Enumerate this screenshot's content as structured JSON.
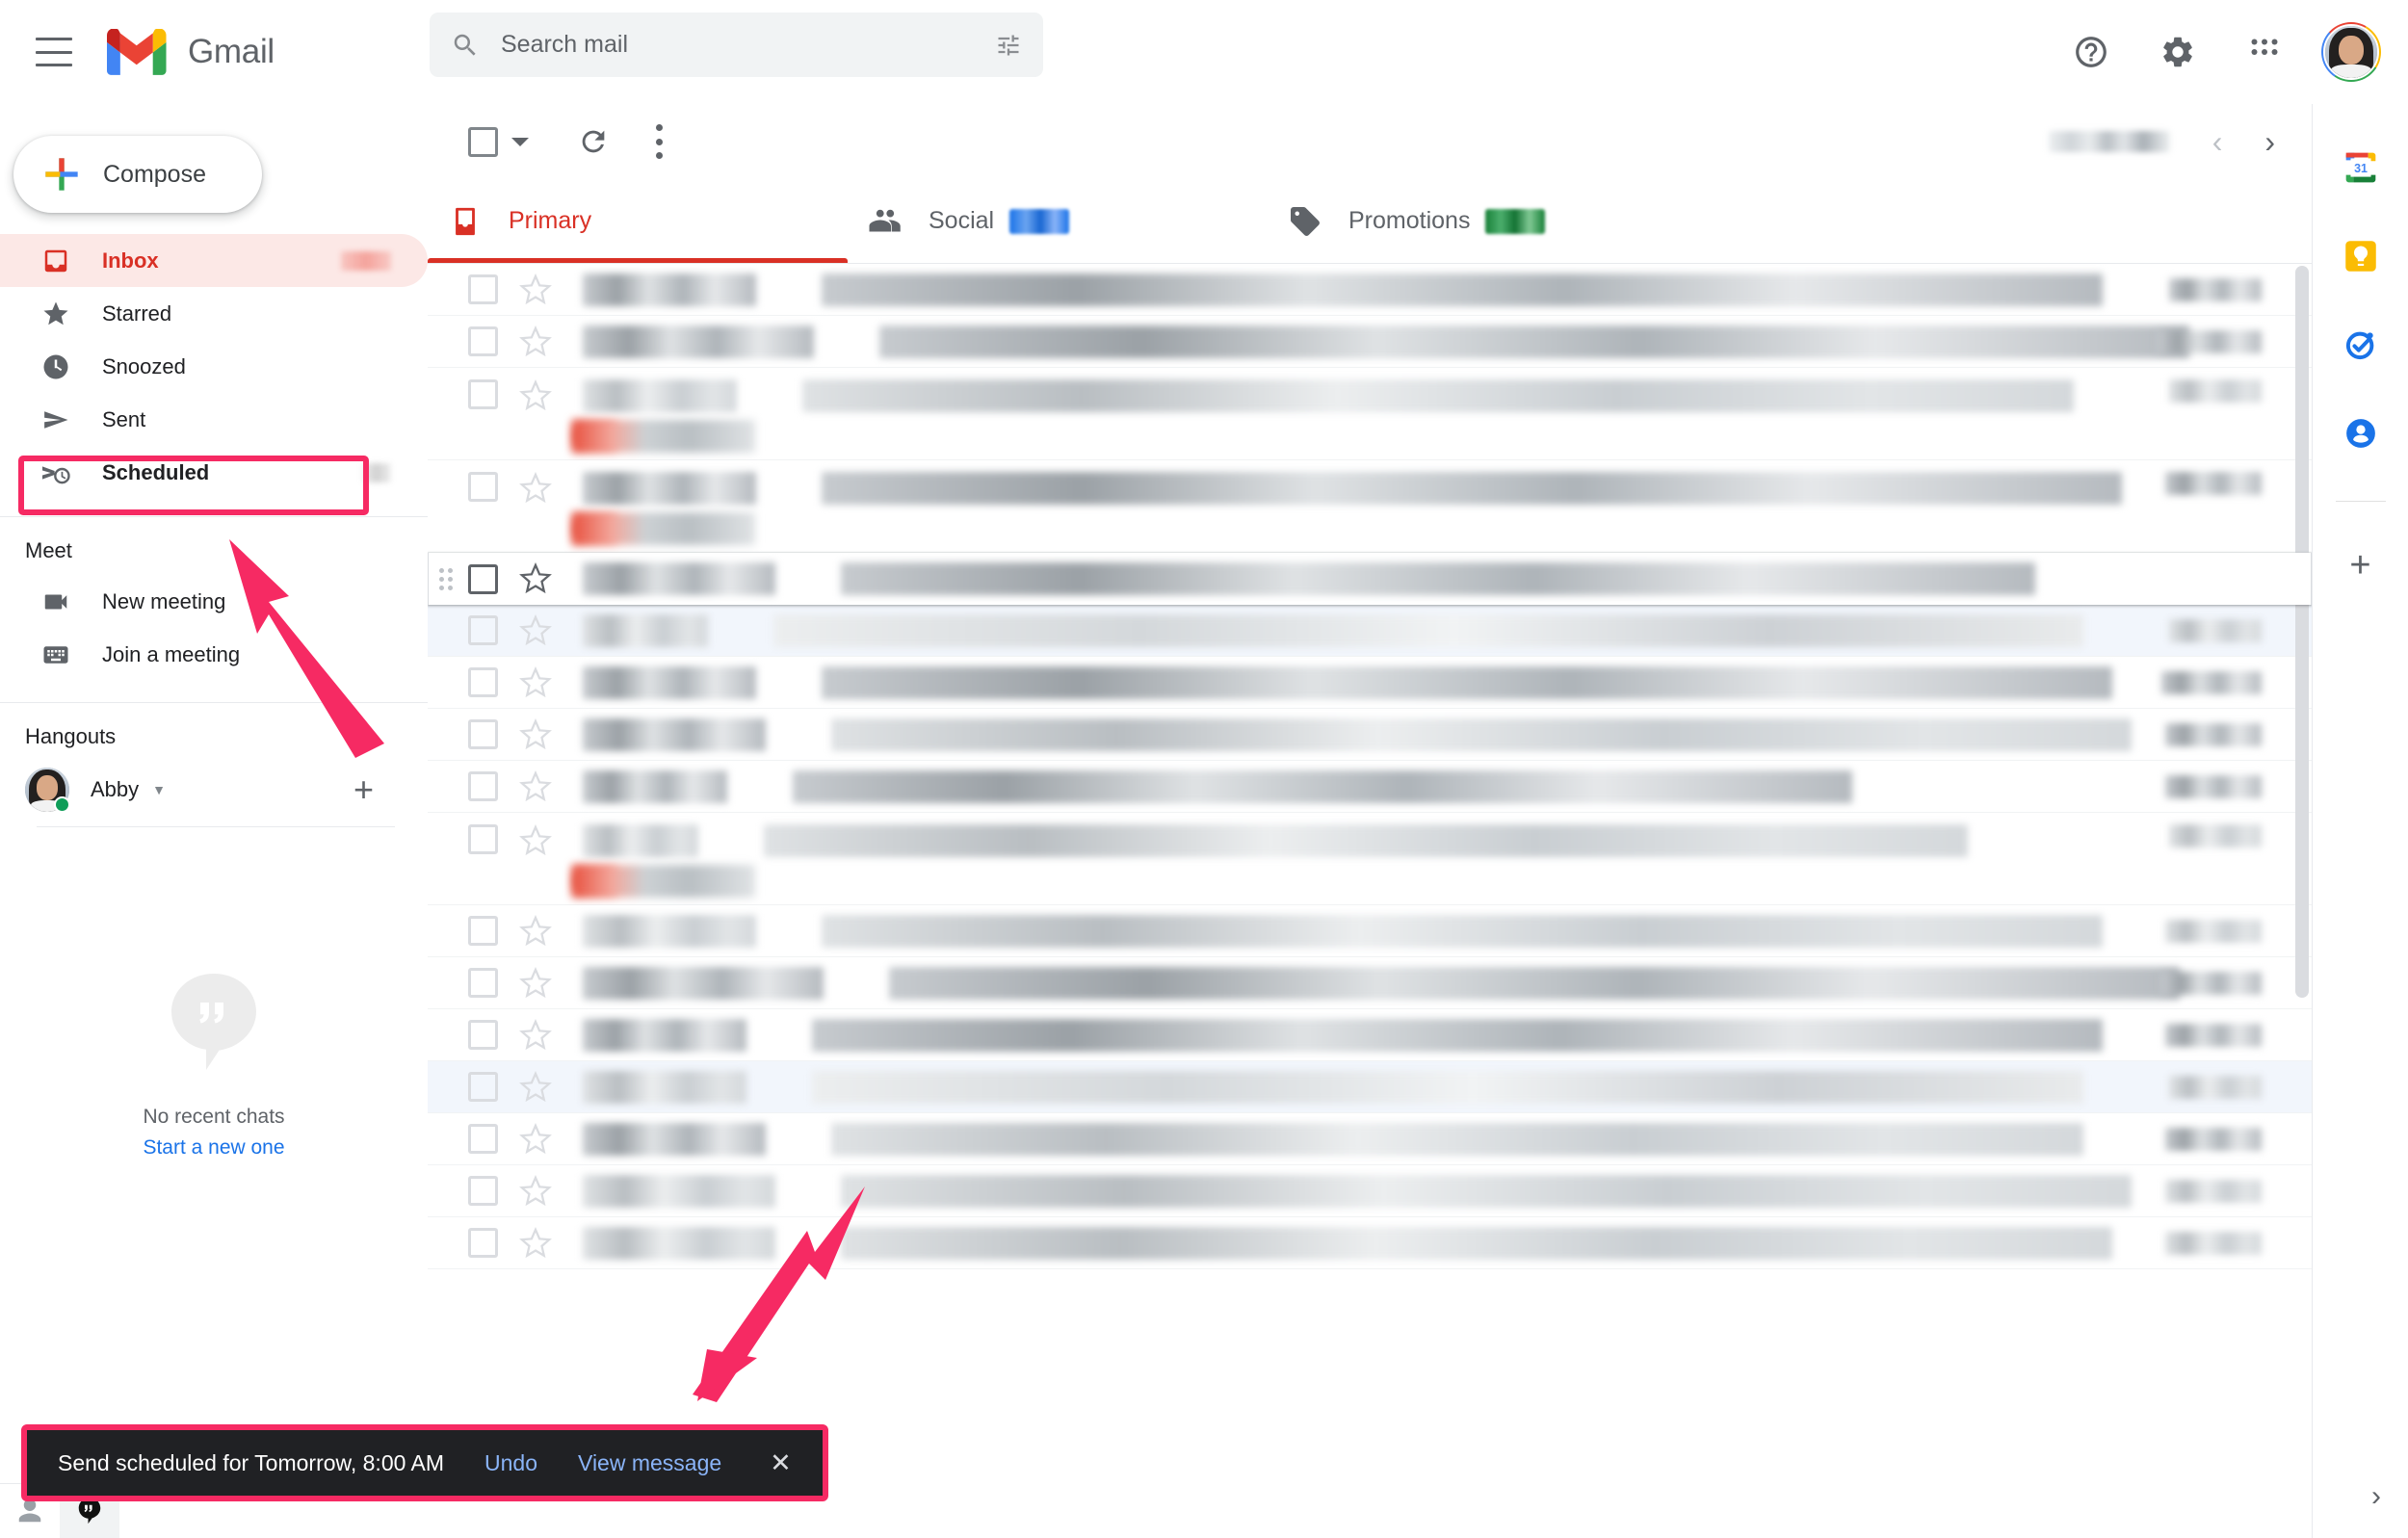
{
  "app": {
    "name": "Gmail"
  },
  "header": {
    "menu_icon": "hamburger-menu-icon",
    "logo_icon": "gmail-logo-icon",
    "brand": "Gmail",
    "help_icon": "help-icon",
    "settings_icon": "gear-icon",
    "apps_icon": "apps-grid-icon",
    "avatar_icon": "user-avatar"
  },
  "search": {
    "placeholder": "Search mail",
    "value": "",
    "icon": "search-icon",
    "options_icon": "search-options-icon"
  },
  "sidebar": {
    "compose_label": "Compose",
    "compose_icon": "plus-icon",
    "items": [
      {
        "label": "Inbox",
        "icon": "inbox-icon",
        "active": true,
        "badge_redacted": true
      },
      {
        "label": "Starred",
        "icon": "star-icon",
        "active": false,
        "badge_redacted": false
      },
      {
        "label": "Snoozed",
        "icon": "clock-icon",
        "active": false,
        "badge_redacted": false
      },
      {
        "label": "Sent",
        "icon": "send-icon",
        "active": false,
        "badge_redacted": false
      },
      {
        "label": "Scheduled",
        "icon": "scheduled-icon",
        "active": false,
        "badge_redacted": true,
        "highlighted": true
      }
    ],
    "meet": {
      "title": "Meet",
      "items": [
        {
          "label": "New meeting",
          "icon": "video-camera-icon"
        },
        {
          "label": "Join a meeting",
          "icon": "keyboard-icon"
        }
      ]
    },
    "hangouts": {
      "title": "Hangouts",
      "user": "Abby",
      "status": "available",
      "caret_icon": "chevron-down-icon",
      "add_icon": "plus-icon",
      "empty_title": "No recent chats",
      "empty_link": "Start a new one",
      "empty_icon": "hangouts-bubble-icon"
    },
    "chatbar": {
      "contacts_icon": "person-icon",
      "hangouts_icon": "hangouts-icon"
    }
  },
  "toolbar": {
    "select_all_icon": "checkbox-icon",
    "select_caret_icon": "chevron-down-icon",
    "refresh_icon": "refresh-icon",
    "more_icon": "more-vertical-icon",
    "page_count": "",
    "page_count_redacted": true,
    "prev_icon": "chevron-left-icon",
    "next_icon": "chevron-right-icon"
  },
  "tabs": [
    {
      "label": "Primary",
      "icon": "inbox-tab-icon",
      "selected": true,
      "sub_redacted": false,
      "pill": null
    },
    {
      "label": "Social",
      "icon": "people-icon",
      "selected": false,
      "sub_redacted": true,
      "pill": "blue"
    },
    {
      "label": "Promotions",
      "icon": "tag-icon",
      "selected": false,
      "sub_redacted": true,
      "pill": "green"
    }
  ],
  "mail_rows": [
    {
      "id": 1,
      "redacted": true,
      "tall": false,
      "hovered": false,
      "alt": false,
      "sender_w": 180,
      "subject_w": 1330,
      "date_w": 96,
      "sender_tone": "blk-b",
      "subject_tone": "blk-b",
      "snippet_red": false
    },
    {
      "id": 2,
      "redacted": true,
      "tall": false,
      "hovered": false,
      "alt": false,
      "sender_w": 240,
      "subject_w": 1360,
      "date_w": 108,
      "sender_tone": "blk-b",
      "subject_tone": "blk-b",
      "snippet_red": false
    },
    {
      "id": 3,
      "redacted": true,
      "tall": true,
      "hovered": false,
      "alt": false,
      "sender_w": 160,
      "subject_w": 1320,
      "date_w": 96,
      "sender_tone": "blk-c",
      "subject_tone": "blk-c",
      "snippet_red": true
    },
    {
      "id": 4,
      "redacted": true,
      "tall": true,
      "hovered": false,
      "alt": false,
      "sender_w": 180,
      "subject_w": 1350,
      "date_w": 100,
      "sender_tone": "blk-b",
      "subject_tone": "blk-b",
      "snippet_red": true
    },
    {
      "id": 5,
      "redacted": true,
      "tall": false,
      "hovered": true,
      "alt": false,
      "sender_w": 200,
      "subject_w": 1240,
      "date_w": 0,
      "sender_tone": "blk-b",
      "subject_tone": "blk-b",
      "snippet_red": false
    },
    {
      "id": 6,
      "redacted": true,
      "tall": false,
      "hovered": false,
      "alt": true,
      "sender_w": 130,
      "subject_w": 1360,
      "date_w": 96,
      "sender_tone": "blk-c",
      "subject_tone": "blk-d",
      "snippet_red": false
    },
    {
      "id": 7,
      "redacted": true,
      "tall": false,
      "hovered": false,
      "alt": false,
      "sender_w": 180,
      "subject_w": 1340,
      "date_w": 104,
      "sender_tone": "blk-b",
      "subject_tone": "blk-b",
      "snippet_red": false
    },
    {
      "id": 8,
      "redacted": true,
      "tall": false,
      "hovered": false,
      "alt": false,
      "sender_w": 190,
      "subject_w": 1350,
      "date_w": 100,
      "sender_tone": "blk-b",
      "subject_tone": "blk-c",
      "snippet_red": false
    },
    {
      "id": 9,
      "redacted": true,
      "tall": false,
      "hovered": false,
      "alt": false,
      "sender_w": 150,
      "subject_w": 1100,
      "date_w": 100,
      "sender_tone": "blk-b",
      "subject_tone": "blk-b",
      "snippet_red": false
    },
    {
      "id": 10,
      "redacted": true,
      "tall": true,
      "hovered": false,
      "alt": false,
      "sender_w": 120,
      "subject_w": 1250,
      "date_w": 96,
      "sender_tone": "blk-c",
      "subject_tone": "blk-c",
      "snippet_red": true
    },
    {
      "id": 11,
      "redacted": true,
      "tall": false,
      "hovered": false,
      "alt": false,
      "sender_w": 180,
      "subject_w": 1330,
      "date_w": 100,
      "sender_tone": "blk-c",
      "subject_tone": "blk-c",
      "snippet_red": false
    },
    {
      "id": 12,
      "redacted": true,
      "tall": false,
      "hovered": false,
      "alt": false,
      "sender_w": 250,
      "subject_w": 1340,
      "date_w": 104,
      "sender_tone": "blk-b",
      "subject_tone": "blk-b",
      "snippet_red": false
    },
    {
      "id": 13,
      "redacted": true,
      "tall": false,
      "hovered": false,
      "alt": false,
      "sender_w": 170,
      "subject_w": 1340,
      "date_w": 100,
      "sender_tone": "blk-b",
      "subject_tone": "blk-b",
      "snippet_red": false
    },
    {
      "id": 14,
      "redacted": true,
      "tall": false,
      "hovered": false,
      "alt": true,
      "sender_w": 170,
      "subject_w": 1320,
      "date_w": 96,
      "sender_tone": "blk-c",
      "subject_tone": "blk-d",
      "snippet_red": false
    },
    {
      "id": 15,
      "redacted": true,
      "tall": false,
      "hovered": false,
      "alt": false,
      "sender_w": 190,
      "subject_w": 1300,
      "date_w": 100,
      "sender_tone": "blk-b",
      "subject_tone": "blk-c",
      "snippet_red": false
    },
    {
      "id": 16,
      "redacted": true,
      "tall": false,
      "hovered": false,
      "alt": false,
      "sender_w": 200,
      "subject_w": 1340,
      "date_w": 100,
      "sender_tone": "blk-c",
      "subject_tone": "blk-c",
      "snippet_red": false
    },
    {
      "id": 17,
      "redacted": true,
      "tall": false,
      "hovered": false,
      "alt": false,
      "sender_w": 200,
      "subject_w": 1320,
      "date_w": 100,
      "sender_tone": "blk-c",
      "subject_tone": "blk-c",
      "snippet_red": false
    }
  ],
  "rail": {
    "items": [
      {
        "icon": "google-calendar-icon",
        "label": "Calendar"
      },
      {
        "icon": "google-keep-icon",
        "label": "Keep"
      },
      {
        "icon": "google-tasks-icon",
        "label": "Tasks"
      },
      {
        "icon": "google-contacts-icon",
        "label": "Contacts"
      }
    ],
    "add_icon": "plus-icon",
    "expand_icon": "chevron-right-icon"
  },
  "toast": {
    "message": "Send scheduled for Tomorrow, 8:00 AM",
    "undo_label": "Undo",
    "view_label": "View message",
    "close_icon": "close-icon"
  },
  "annotation": {
    "color": "#f62a63",
    "highlight_target": "Scheduled",
    "arrows": 2
  },
  "colors": {
    "accent_pink": "#f62a63",
    "gmail_red": "#d93025",
    "link_blue": "#1a73e8",
    "toast_bg": "#202124",
    "toast_link": "#8ab4f8"
  }
}
